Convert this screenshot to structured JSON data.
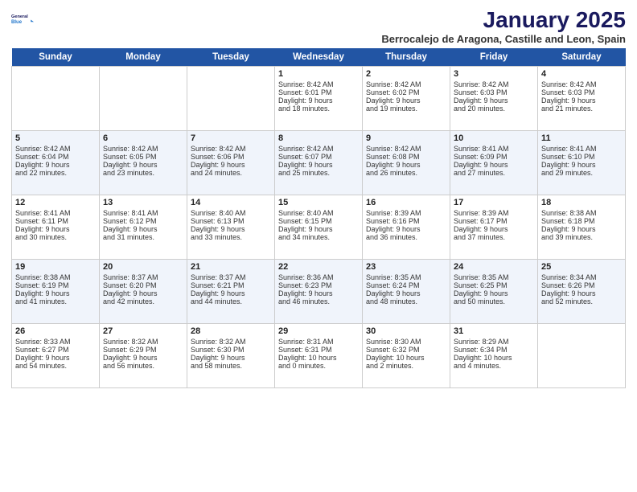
{
  "header": {
    "logo_line1": "General",
    "logo_line2": "Blue",
    "title": "January 2025",
    "subtitle": "Berrocalejo de Aragona, Castille and Leon, Spain"
  },
  "days_of_week": [
    "Sunday",
    "Monday",
    "Tuesday",
    "Wednesday",
    "Thursday",
    "Friday",
    "Saturday"
  ],
  "weeks": [
    {
      "cells": [
        {
          "day": null,
          "content": []
        },
        {
          "day": null,
          "content": []
        },
        {
          "day": null,
          "content": []
        },
        {
          "day": "1",
          "content": [
            "Sunrise: 8:42 AM",
            "Sunset: 6:01 PM",
            "Daylight: 9 hours",
            "and 18 minutes."
          ]
        },
        {
          "day": "2",
          "content": [
            "Sunrise: 8:42 AM",
            "Sunset: 6:02 PM",
            "Daylight: 9 hours",
            "and 19 minutes."
          ]
        },
        {
          "day": "3",
          "content": [
            "Sunrise: 8:42 AM",
            "Sunset: 6:03 PM",
            "Daylight: 9 hours",
            "and 20 minutes."
          ]
        },
        {
          "day": "4",
          "content": [
            "Sunrise: 8:42 AM",
            "Sunset: 6:03 PM",
            "Daylight: 9 hours",
            "and 21 minutes."
          ]
        }
      ]
    },
    {
      "cells": [
        {
          "day": "5",
          "content": [
            "Sunrise: 8:42 AM",
            "Sunset: 6:04 PM",
            "Daylight: 9 hours",
            "and 22 minutes."
          ]
        },
        {
          "day": "6",
          "content": [
            "Sunrise: 8:42 AM",
            "Sunset: 6:05 PM",
            "Daylight: 9 hours",
            "and 23 minutes."
          ]
        },
        {
          "day": "7",
          "content": [
            "Sunrise: 8:42 AM",
            "Sunset: 6:06 PM",
            "Daylight: 9 hours",
            "and 24 minutes."
          ]
        },
        {
          "day": "8",
          "content": [
            "Sunrise: 8:42 AM",
            "Sunset: 6:07 PM",
            "Daylight: 9 hours",
            "and 25 minutes."
          ]
        },
        {
          "day": "9",
          "content": [
            "Sunrise: 8:42 AM",
            "Sunset: 6:08 PM",
            "Daylight: 9 hours",
            "and 26 minutes."
          ]
        },
        {
          "day": "10",
          "content": [
            "Sunrise: 8:41 AM",
            "Sunset: 6:09 PM",
            "Daylight: 9 hours",
            "and 27 minutes."
          ]
        },
        {
          "day": "11",
          "content": [
            "Sunrise: 8:41 AM",
            "Sunset: 6:10 PM",
            "Daylight: 9 hours",
            "and 29 minutes."
          ]
        }
      ]
    },
    {
      "cells": [
        {
          "day": "12",
          "content": [
            "Sunrise: 8:41 AM",
            "Sunset: 6:11 PM",
            "Daylight: 9 hours",
            "and 30 minutes."
          ]
        },
        {
          "day": "13",
          "content": [
            "Sunrise: 8:41 AM",
            "Sunset: 6:12 PM",
            "Daylight: 9 hours",
            "and 31 minutes."
          ]
        },
        {
          "day": "14",
          "content": [
            "Sunrise: 8:40 AM",
            "Sunset: 6:13 PM",
            "Daylight: 9 hours",
            "and 33 minutes."
          ]
        },
        {
          "day": "15",
          "content": [
            "Sunrise: 8:40 AM",
            "Sunset: 6:15 PM",
            "Daylight: 9 hours",
            "and 34 minutes."
          ]
        },
        {
          "day": "16",
          "content": [
            "Sunrise: 8:39 AM",
            "Sunset: 6:16 PM",
            "Daylight: 9 hours",
            "and 36 minutes."
          ]
        },
        {
          "day": "17",
          "content": [
            "Sunrise: 8:39 AM",
            "Sunset: 6:17 PM",
            "Daylight: 9 hours",
            "and 37 minutes."
          ]
        },
        {
          "day": "18",
          "content": [
            "Sunrise: 8:38 AM",
            "Sunset: 6:18 PM",
            "Daylight: 9 hours",
            "and 39 minutes."
          ]
        }
      ]
    },
    {
      "cells": [
        {
          "day": "19",
          "content": [
            "Sunrise: 8:38 AM",
            "Sunset: 6:19 PM",
            "Daylight: 9 hours",
            "and 41 minutes."
          ]
        },
        {
          "day": "20",
          "content": [
            "Sunrise: 8:37 AM",
            "Sunset: 6:20 PM",
            "Daylight: 9 hours",
            "and 42 minutes."
          ]
        },
        {
          "day": "21",
          "content": [
            "Sunrise: 8:37 AM",
            "Sunset: 6:21 PM",
            "Daylight: 9 hours",
            "and 44 minutes."
          ]
        },
        {
          "day": "22",
          "content": [
            "Sunrise: 8:36 AM",
            "Sunset: 6:23 PM",
            "Daylight: 9 hours",
            "and 46 minutes."
          ]
        },
        {
          "day": "23",
          "content": [
            "Sunrise: 8:35 AM",
            "Sunset: 6:24 PM",
            "Daylight: 9 hours",
            "and 48 minutes."
          ]
        },
        {
          "day": "24",
          "content": [
            "Sunrise: 8:35 AM",
            "Sunset: 6:25 PM",
            "Daylight: 9 hours",
            "and 50 minutes."
          ]
        },
        {
          "day": "25",
          "content": [
            "Sunrise: 8:34 AM",
            "Sunset: 6:26 PM",
            "Daylight: 9 hours",
            "and 52 minutes."
          ]
        }
      ]
    },
    {
      "cells": [
        {
          "day": "26",
          "content": [
            "Sunrise: 8:33 AM",
            "Sunset: 6:27 PM",
            "Daylight: 9 hours",
            "and 54 minutes."
          ]
        },
        {
          "day": "27",
          "content": [
            "Sunrise: 8:32 AM",
            "Sunset: 6:29 PM",
            "Daylight: 9 hours",
            "and 56 minutes."
          ]
        },
        {
          "day": "28",
          "content": [
            "Sunrise: 8:32 AM",
            "Sunset: 6:30 PM",
            "Daylight: 9 hours",
            "and 58 minutes."
          ]
        },
        {
          "day": "29",
          "content": [
            "Sunrise: 8:31 AM",
            "Sunset: 6:31 PM",
            "Daylight: 10 hours",
            "and 0 minutes."
          ]
        },
        {
          "day": "30",
          "content": [
            "Sunrise: 8:30 AM",
            "Sunset: 6:32 PM",
            "Daylight: 10 hours",
            "and 2 minutes."
          ]
        },
        {
          "day": "31",
          "content": [
            "Sunrise: 8:29 AM",
            "Sunset: 6:34 PM",
            "Daylight: 10 hours",
            "and 4 minutes."
          ]
        },
        {
          "day": null,
          "content": []
        }
      ]
    }
  ]
}
